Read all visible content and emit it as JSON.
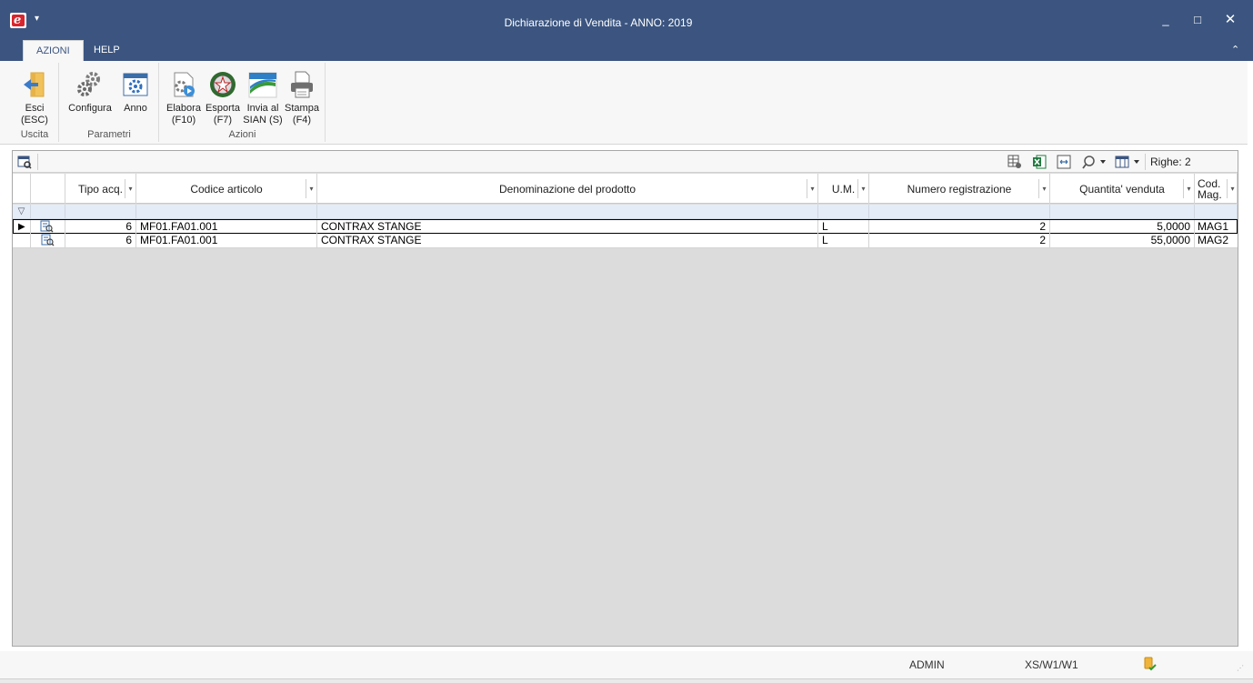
{
  "window": {
    "title": "Dichiarazione di Vendita - ANNO: 2019",
    "logo_letter": "e",
    "minimize": "_",
    "maximize": "□",
    "close": "✕"
  },
  "ribbon": {
    "tabs": [
      {
        "label": "AZIONI",
        "active": true
      },
      {
        "label": "HELP",
        "active": false
      }
    ],
    "groups": {
      "uscita": {
        "label": "Uscita",
        "buttons": [
          {
            "label1": "Esci",
            "label2": "(ESC)",
            "icon": "exit-icon"
          }
        ]
      },
      "parametri": {
        "label": "Parametri",
        "buttons": [
          {
            "label1": "Configura",
            "label2": "",
            "icon": "gears-icon"
          },
          {
            "label1": "Anno",
            "label2": "",
            "icon": "calendar-gear-icon"
          }
        ]
      },
      "azioni": {
        "label": "Azioni",
        "buttons": [
          {
            "label1": "Elabora",
            "label2": "(F10)",
            "icon": "process-icon"
          },
          {
            "label1": "Esporta",
            "label2": "(F7)",
            "icon": "italian-emblem-icon"
          },
          {
            "label1": "Invia al",
            "label2": "SIAN (S)",
            "icon": "sian-logo-icon"
          },
          {
            "label1": "Stampa",
            "label2": "(F4)",
            "icon": "printer-icon"
          }
        ]
      }
    }
  },
  "grid": {
    "row_count_label": "Righe: 2",
    "columns": [
      "Tipo acq.",
      "Codice articolo",
      "Denominazione del prodotto",
      "U.M.",
      "Numero registrazione",
      "Quantita' venduta",
      "Cod.",
      "Mag."
    ],
    "rows": [
      {
        "tipo": "6",
        "codice": "MF01.FA01.001",
        "denominazione": "CONTRAX STANGE",
        "um": "L",
        "numero": "2",
        "quantita": "5,0000",
        "mag": "MAG1"
      },
      {
        "tipo": "6",
        "codice": "MF01.FA01.001",
        "denominazione": "CONTRAX STANGE",
        "um": "L",
        "numero": "2",
        "quantita": "55,0000",
        "mag": "MAG2"
      }
    ]
  },
  "status": {
    "user": "ADMIN",
    "workstation": "XS/W1/W1"
  },
  "colors": {
    "titlebar": "#3b5580",
    "ribbon_bg": "#f7f7f7",
    "grid_bg": "#dcdcdc",
    "filter_row": "#e4ecf7"
  }
}
